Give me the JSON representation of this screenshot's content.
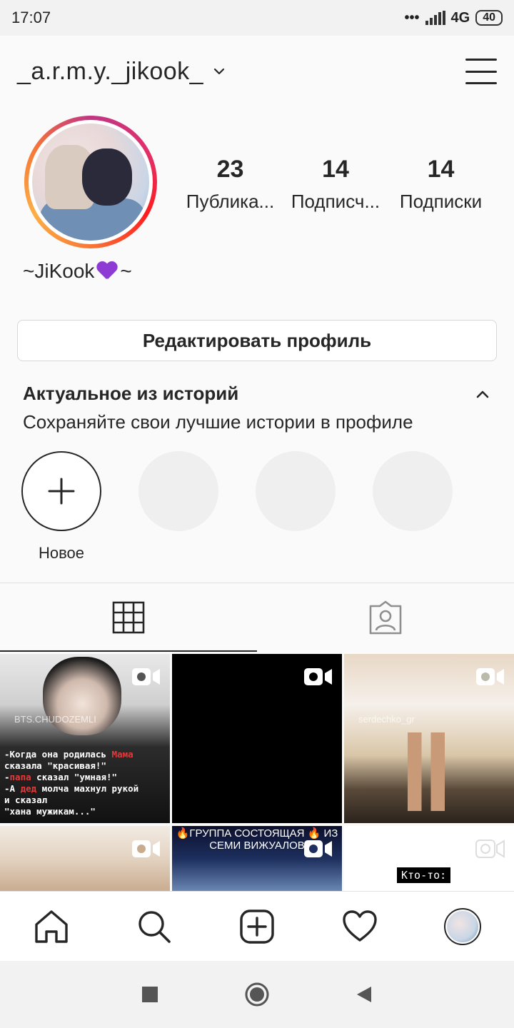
{
  "status_bar": {
    "time": "17:07",
    "dots": "•••",
    "network": "4G",
    "battery": "40"
  },
  "header": {
    "username": "_a.r.m.y._jikook_",
    "icons": [
      "chevron-down-icon",
      "hamburger-menu-icon"
    ]
  },
  "profile": {
    "display_name_prefix": "~JiKook",
    "display_name_suffix": "~",
    "stats": [
      {
        "count": "23",
        "label": "Публика..."
      },
      {
        "count": "14",
        "label": "Подписч..."
      },
      {
        "count": "14",
        "label": "Подписки"
      }
    ],
    "edit_button": "Редактировать профиль"
  },
  "highlights": {
    "title": "Актуальное из историй",
    "subtitle": "Сохраняйте свои лучшие истории в профиле",
    "new_label": "Новое"
  },
  "tabs": [
    {
      "icon": "grid-icon",
      "active": true
    },
    {
      "icon": "tagged-person-icon",
      "active": false
    }
  ],
  "posts": {
    "post1_watermark": "BTS.CHUDOZEMLI",
    "post1_lines": [
      {
        "parts": [
          "-Когда она родилась ",
          "Мама"
        ]
      },
      {
        "parts": [
          "сказала \"красивая!\""
        ]
      },
      {
        "parts": [
          "-",
          "папа",
          " сказал \"умная!\""
        ]
      },
      {
        "parts": [
          "-А ",
          "дед",
          " молча махнул рукой"
        ]
      },
      {
        "parts": [
          "и сказал"
        ]
      },
      {
        "parts": [
          "\"хана мужикам...\""
        ]
      }
    ],
    "post3_watermark": "serdechko_gr",
    "post5_caption": "🔥ГРУППА СОСТОЯЩАЯ 🔥 ИЗ СЕМИ ВИЖУАЛОВ",
    "post6_label": "Кто-то:"
  },
  "bottom_nav": [
    "home-icon",
    "search-icon",
    "add-post-icon",
    "activity-heart-icon",
    "profile-avatar"
  ],
  "system_nav": [
    "recents-square-icon",
    "home-circle-icon",
    "back-triangle-icon"
  ],
  "colors": {
    "text": "#262626",
    "background": "#fafafa",
    "highlight_placeholder": "#efefef",
    "ring_gradient": [
      "#c13584",
      "#e1306c",
      "#fd1d1d",
      "#f77737",
      "#fcaf45"
    ]
  }
}
